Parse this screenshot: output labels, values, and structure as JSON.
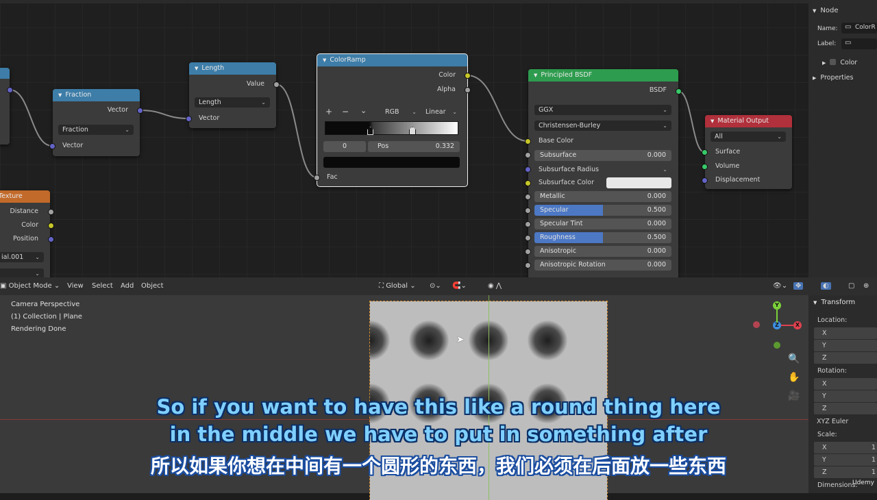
{
  "nodes": {
    "fraction": {
      "title": "Fraction",
      "output": "Vector",
      "mode": "Fraction",
      "input": "Vector"
    },
    "length": {
      "title": "Length",
      "output": "Value",
      "mode": "Length",
      "input": "Vector"
    },
    "colorramp": {
      "title": "ColorRamp",
      "out_color": "Color",
      "out_alpha": "Alpha",
      "btn_add": "+",
      "btn_remove": "−",
      "btn_menu": "⌄",
      "color_mode": "RGB",
      "interpolation": "Linear",
      "index": "0",
      "pos_label": "Pos",
      "pos_value": "0.332",
      "input": "Fac"
    },
    "texture": {
      "title": "Texture",
      "out_distance": "Distance",
      "out_color": "Color",
      "out_position": "Position",
      "selector": "ial.001"
    },
    "principled": {
      "title": "Principled BSDF",
      "output": "BSDF",
      "distribution": "GGX",
      "subsurface_method": "Christensen-Burley",
      "base_color": "Base Color",
      "fields": [
        {
          "label": "Subsurface",
          "value": "0.000",
          "fill": 0
        },
        {
          "label": "Subsurface Radius",
          "value": "",
          "fill": 0
        },
        {
          "label": "Subsurface Color",
          "value": "",
          "fill": 0
        },
        {
          "label": "Metallic",
          "value": "0.000",
          "fill": 0
        },
        {
          "label": "Specular",
          "value": "0.500",
          "fill": 0.5
        },
        {
          "label": "Specular Tint",
          "value": "0.000",
          "fill": 0
        },
        {
          "label": "Roughness",
          "value": "0.500",
          "fill": 0.5
        },
        {
          "label": "Anisotropic",
          "value": "0.000",
          "fill": 0
        },
        {
          "label": "Anisotropic Rotation",
          "value": "0.000",
          "fill": 0
        }
      ]
    },
    "output": {
      "title": "Material Output",
      "target": "All",
      "surface": "Surface",
      "volume": "Volume",
      "displacement": "Displacement"
    }
  },
  "node_sidebar": {
    "section": "Node",
    "name_label": "Name:",
    "name_value": "ColorR",
    "label_label": "Label:",
    "color": "Color",
    "properties": "Properties"
  },
  "viewport_header": {
    "mode": "Object Mode",
    "menu": [
      "View",
      "Select",
      "Add",
      "Object"
    ],
    "orientation": "Global"
  },
  "viewport": {
    "overlay_lines": [
      "Camera Perspective",
      "(1) Collection | Plane",
      "Rendering Done"
    ],
    "gizmo": {
      "x": "X",
      "y": "Y",
      "z": "Z"
    }
  },
  "n_panel": {
    "section": "Transform",
    "location": "Location:",
    "rotation": "Rotation:",
    "rotation_mode": "XYZ Euler",
    "scale": "Scale:",
    "dimensions": "Dimensions:",
    "axes": [
      "X",
      "Y",
      "Z"
    ],
    "scale_values": [
      "1",
      "1",
      "1"
    ]
  },
  "subtitles": {
    "en_line1": "So if you want to have this like a round thing here",
    "en_line2": "in the middle we have to put in something after",
    "cn_line": "所以如果你想在中间有一个圆形的东西，我们必须在后面放一些东西"
  },
  "watermark": "Udemy",
  "colors": {
    "socket_yellow": "#c7c729",
    "socket_gray": "#a1a1a1",
    "socket_purple": "#6363c7",
    "socket_green": "#39c96a",
    "header_blue": "#3d7da8",
    "header_green": "#2e9c4e",
    "header_red": "#b0303b"
  }
}
